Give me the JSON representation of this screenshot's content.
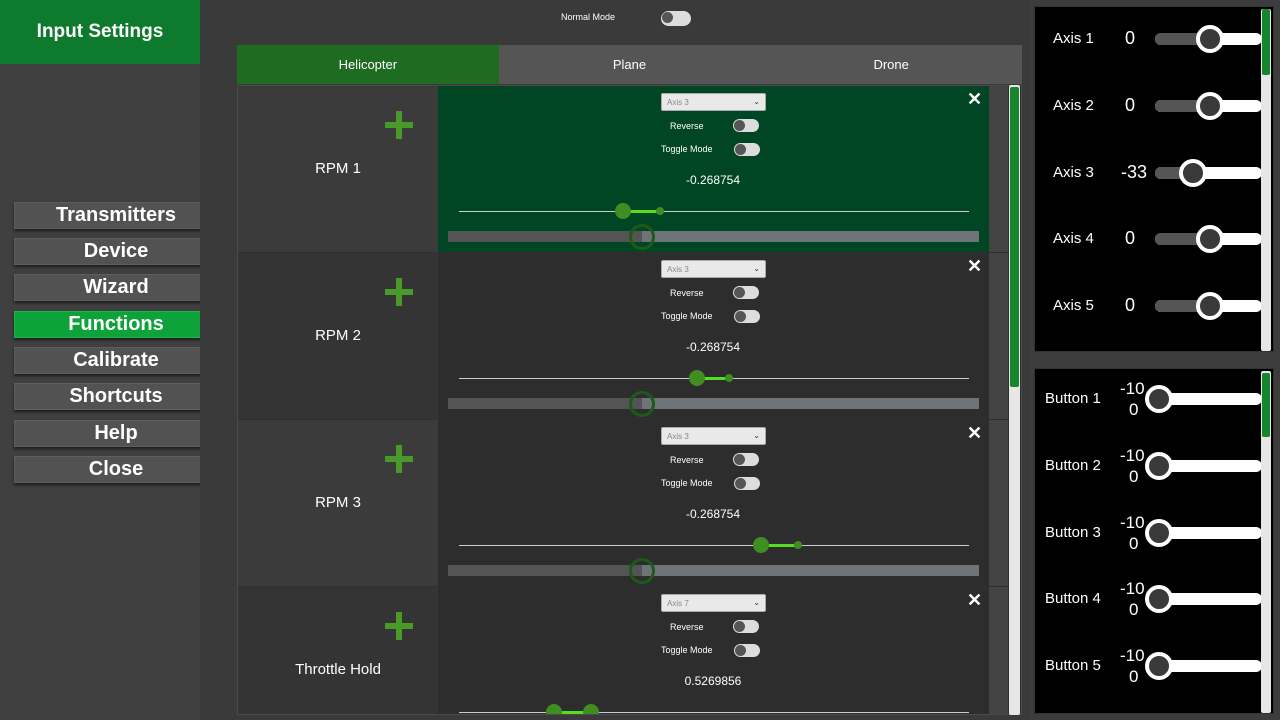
{
  "app_title": "Input Settings",
  "nav": [
    {
      "label": "Transmitters",
      "active": false
    },
    {
      "label": "Device",
      "active": false
    },
    {
      "label": "Wizard",
      "active": false
    },
    {
      "label": "Functions",
      "active": true
    },
    {
      "label": "Calibrate",
      "active": false
    },
    {
      "label": "Shortcuts",
      "active": false
    },
    {
      "label": "Help",
      "active": false
    },
    {
      "label": "Close",
      "active": false
    }
  ],
  "normal_mode_label": "Normal Mode",
  "tabs": [
    {
      "label": "Helicopter",
      "active": true
    },
    {
      "label": "Plane",
      "active": false
    },
    {
      "label": "Drone",
      "active": false
    }
  ],
  "functions": [
    {
      "name": "RPM 1",
      "axis": "Axis 3",
      "reverse_label": "Reverse",
      "toggle_label": "Toggle Mode",
      "value": "-0.268754",
      "active": true
    },
    {
      "name": "RPM 2",
      "axis": "Axis 3",
      "reverse_label": "Reverse",
      "toggle_label": "Toggle Mode",
      "value": "-0.268754",
      "active": false
    },
    {
      "name": "RPM 3",
      "axis": "Axis 3",
      "reverse_label": "Reverse",
      "toggle_label": "Toggle Mode",
      "value": "-0.268754",
      "active": false
    },
    {
      "name": "Throttle Hold",
      "axis": "Axis 7",
      "reverse_label": "Reverse",
      "toggle_label": "Toggle Mode",
      "value": "0.5269856",
      "active": false
    }
  ],
  "close_glyph": "✕",
  "axes": [
    {
      "label": "Axis 1",
      "value": "0"
    },
    {
      "label": "Axis 2",
      "value": "0"
    },
    {
      "label": "Axis 3",
      "value": "-33"
    },
    {
      "label": "Axis 4",
      "value": "0"
    },
    {
      "label": "Axis 5",
      "value": "0"
    }
  ],
  "buttons": [
    {
      "label": "Button 1",
      "top_value": "-10",
      "bottom_value": "0"
    },
    {
      "label": "Button 2",
      "top_value": "-10",
      "bottom_value": "0"
    },
    {
      "label": "Button 3",
      "top_value": "-10",
      "bottom_value": "0"
    },
    {
      "label": "Button 4",
      "top_value": "-10",
      "bottom_value": "0"
    },
    {
      "label": "Button 5",
      "top_value": "-10",
      "bottom_value": "0"
    }
  ],
  "icons": {
    "add": "plus-icon",
    "remove": "close-icon",
    "dropdown": "chevron-down-icon"
  },
  "colors": {
    "accent": "#0e7a2e",
    "active_nav": "#0ea23a",
    "active_row": "#004624",
    "active_tab": "#1e6b22"
  }
}
